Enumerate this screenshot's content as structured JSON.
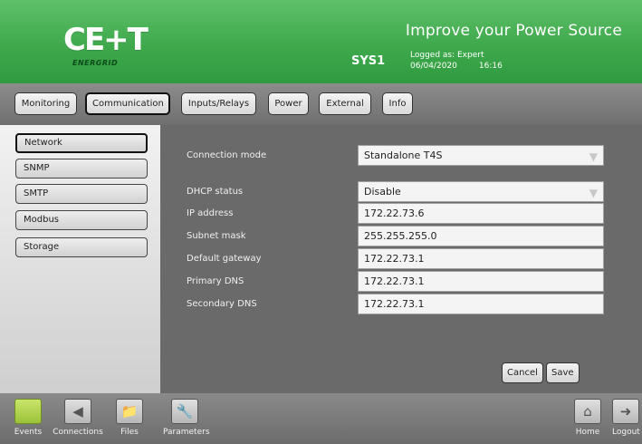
{
  "header": {
    "logo_text": "CE+T",
    "logo_sub": "ENERGRID",
    "tagline": "Improve your Power Source",
    "system_name": "SYS1",
    "logged_as": "Logged as: Expert",
    "date": "06/04/2020",
    "time": "16:16"
  },
  "tabs": [
    {
      "label": "Monitoring",
      "active": false
    },
    {
      "label": "Communication",
      "active": true
    },
    {
      "label": "Inputs/Relays",
      "active": false
    },
    {
      "label": "Power",
      "active": false
    },
    {
      "label": "External",
      "active": false
    },
    {
      "label": "Info",
      "active": false
    }
  ],
  "sidebar": {
    "items": [
      {
        "label": "Network",
        "active": true
      },
      {
        "label": "SNMP",
        "active": false
      },
      {
        "label": "SMTP",
        "active": false
      },
      {
        "label": "Modbus",
        "active": false
      },
      {
        "label": "Storage",
        "active": false
      }
    ]
  },
  "form": {
    "connection_mode": {
      "label": "Connection mode",
      "value": "Standalone T4S"
    },
    "dhcp_status": {
      "label": "DHCP status",
      "value": "Disable"
    },
    "ip_address": {
      "label": "IP address",
      "value": "172.22.73.6"
    },
    "subnet_mask": {
      "label": "Subnet mask",
      "value": "255.255.255.0"
    },
    "default_gateway": {
      "label": "Default gateway",
      "value": "172.22.73.1"
    },
    "primary_dns": {
      "label": "Primary DNS",
      "value": "172.22.73.1"
    },
    "secondary_dns": {
      "label": "Secondary DNS",
      "value": "172.22.73.1"
    },
    "cancel_label": "Cancel",
    "save_label": "Save"
  },
  "footer": {
    "events": "Events",
    "connections": "Connections",
    "files": "Files",
    "parameters": "Parameters",
    "home": "Home",
    "logout": "Logout"
  },
  "icons": {
    "events": "square-icon",
    "connections": "play-icon",
    "files": "folder-icon",
    "parameters": "wrench-icon",
    "home": "home-icon",
    "logout": "logout-icon"
  },
  "colors": {
    "header_green": "#3fa94c",
    "events_green": "#9bc23a",
    "panel_gray": "#6a6a6a"
  }
}
